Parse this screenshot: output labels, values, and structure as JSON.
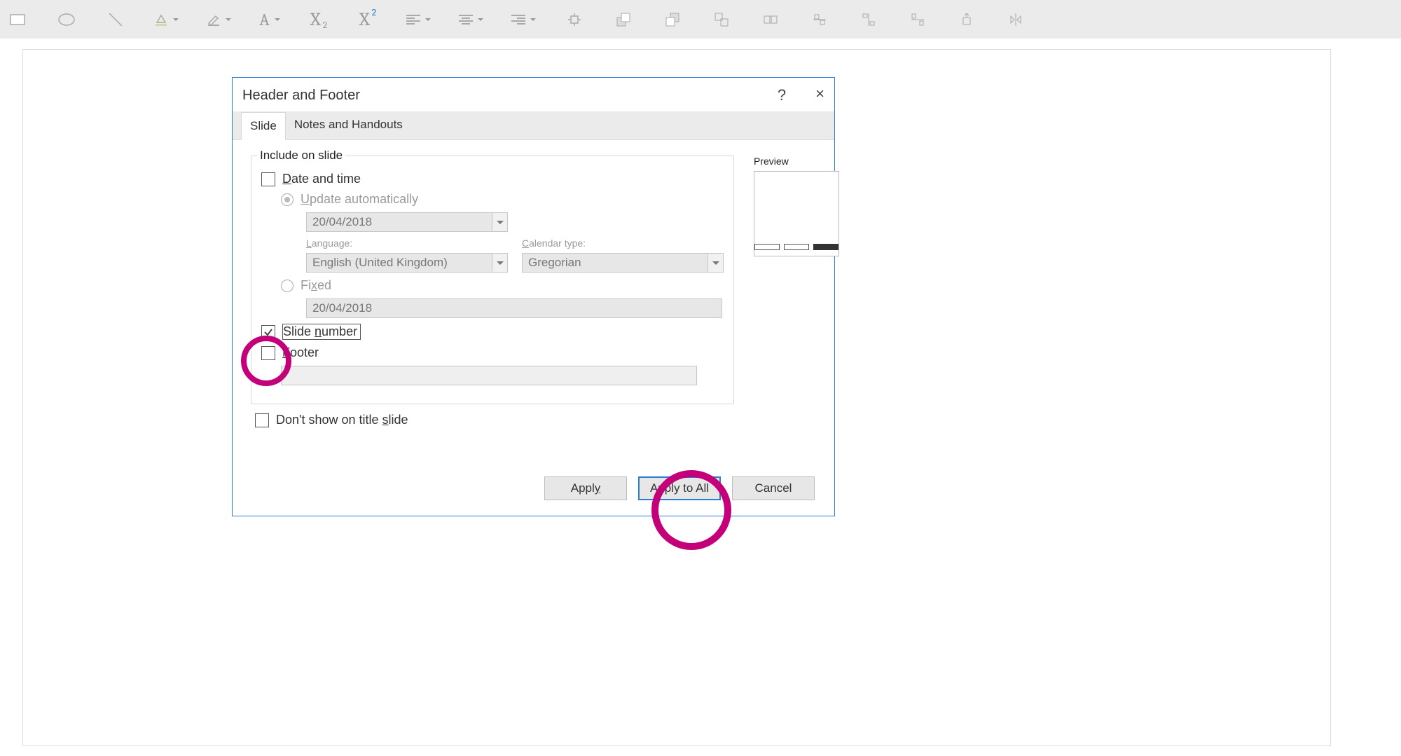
{
  "dialog": {
    "title": "Header and Footer",
    "help_label": "?",
    "close_label": "×",
    "tabs": {
      "slide": "Slide",
      "notes": "Notes and Handouts"
    },
    "include_title": "Include on slide",
    "date_time": "Date and time",
    "update_auto": "Update automatically",
    "date_value": "20/04/2018",
    "language_label": "Language:",
    "language_value": "English (United Kingdom)",
    "calendar_label": "Calendar type:",
    "calendar_value": "Gregorian",
    "fixed_label": "Fixed",
    "fixed_value": "20/04/2018",
    "slide_number": "Slide number",
    "footer_label": "Footer",
    "dont_show": "Don't show on title slide",
    "preview_label": "Preview",
    "apply": "Apply",
    "apply_all": "Apply to All",
    "cancel": "Cancel"
  },
  "ribbon": {
    "x2_sub": "2",
    "x2_sup": "2"
  }
}
